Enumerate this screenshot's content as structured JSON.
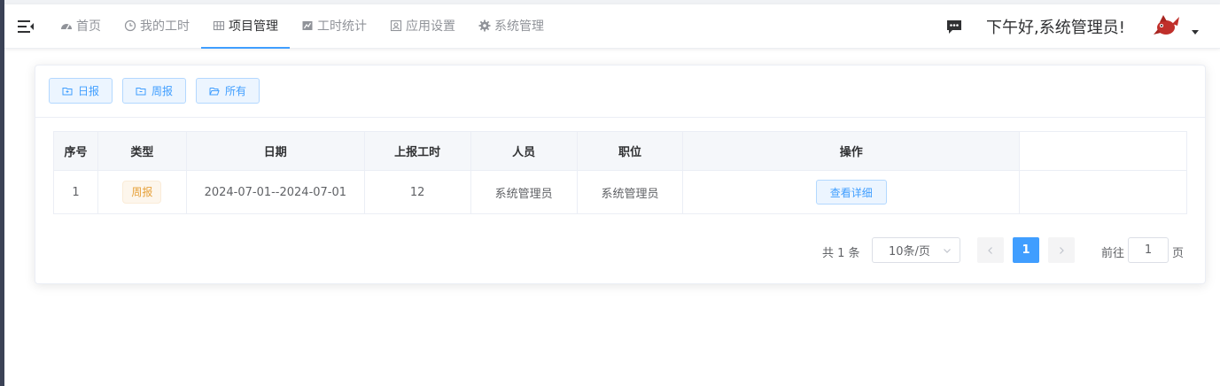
{
  "nav": {
    "items": [
      {
        "label": "首页",
        "icon": "dashboard-icon"
      },
      {
        "label": "我的工时",
        "icon": "clock-icon"
      },
      {
        "label": "项目管理",
        "icon": "grid-icon"
      },
      {
        "label": "工时统计",
        "icon": "chart-icon"
      },
      {
        "label": "应用设置",
        "icon": "app-icon"
      },
      {
        "label": "系统管理",
        "icon": "gear-icon"
      }
    ],
    "active_index": 2,
    "greeting": "下午好,系统管理员!"
  },
  "toolbar": {
    "daily_label": "日报",
    "weekly_label": "周报",
    "all_label": "所有"
  },
  "table": {
    "columns": [
      "序号",
      "类型",
      "日期",
      "上报工时",
      "人员",
      "职位",
      "操作"
    ],
    "rows": [
      {
        "index": "1",
        "type": "周报",
        "date": "2024-07-01--2024-07-01",
        "hours": "12",
        "person": "系统管理员",
        "position": "系统管理员",
        "action": "查看详细"
      }
    ]
  },
  "pagination": {
    "total": "共 1 条",
    "page_size": "10条/页",
    "current_page": "1",
    "goto_prefix": "前往",
    "goto_value": "1",
    "goto_suffix": "页"
  },
  "colors": {
    "accent": "#409eff",
    "warning": "#e6a23c",
    "sidebar_edge": "#3b4256"
  }
}
